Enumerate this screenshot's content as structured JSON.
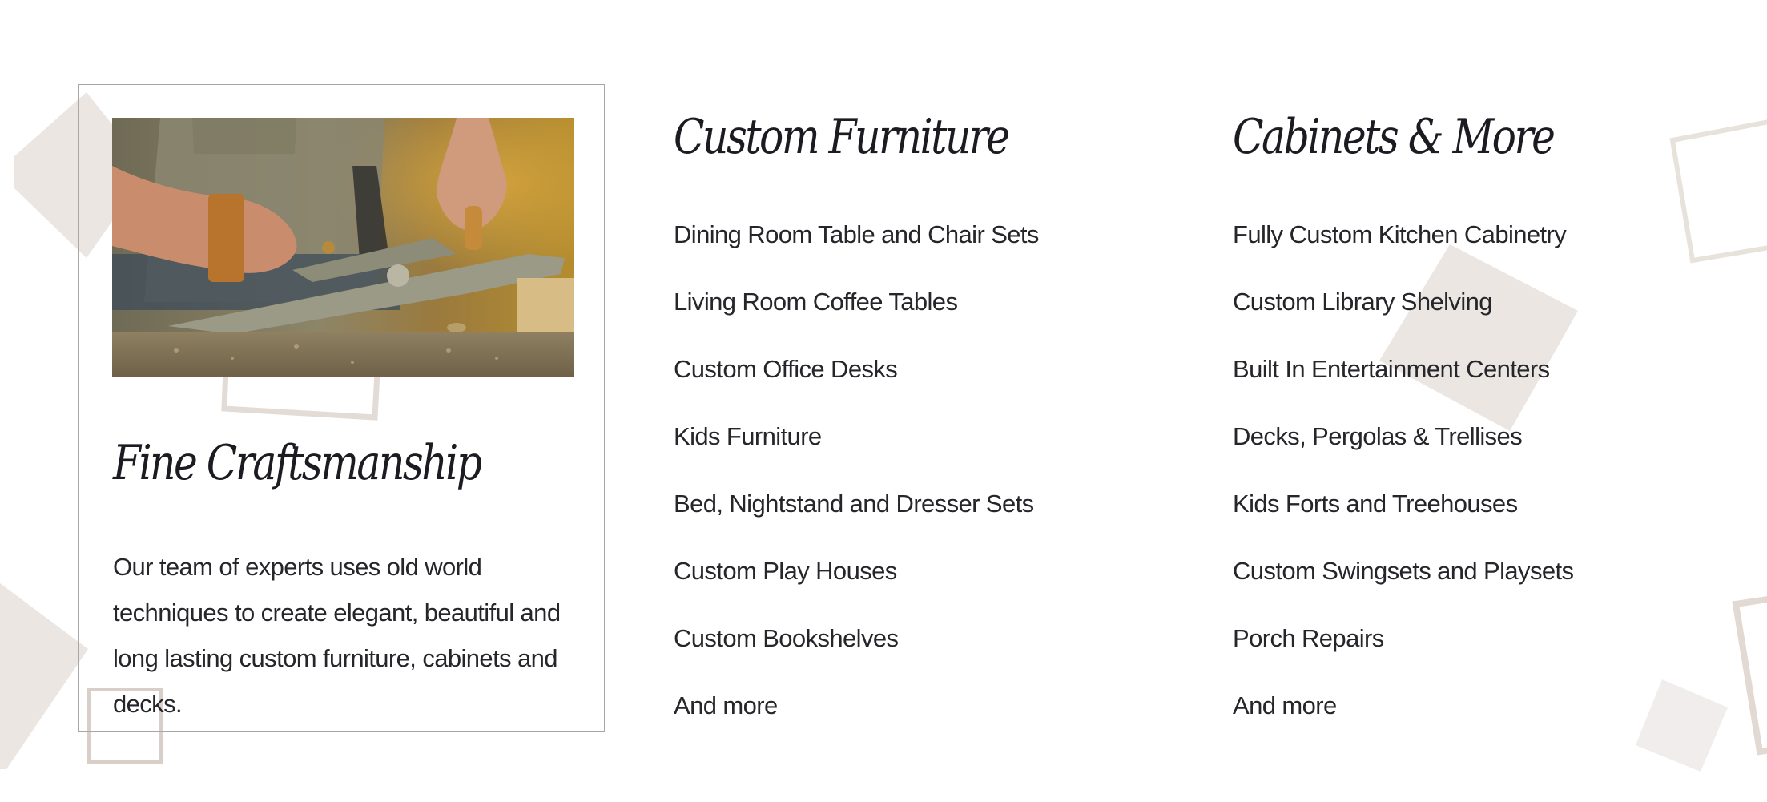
{
  "card": {
    "image_alt": "Craftsman using a hand plane on wood",
    "title": "Fine Craftsmanship",
    "description": "Our team of experts uses old world techniques to create elegant, beautiful and long lasting custom furniture, cabinets and decks."
  },
  "columns": [
    {
      "title": "Custom Furniture",
      "items": [
        "Dining Room Table and Chair Sets",
        "Living Room Coffee Tables",
        "Custom Office Desks",
        "Kids Furniture",
        "Bed, Nightstand and Dresser Sets",
        "Custom Play Houses",
        "Custom Bookshelves",
        "And more"
      ]
    },
    {
      "title": "Cabinets & More",
      "items": [
        "Fully Custom Kitchen Cabinetry",
        "Custom Library Shelving",
        "Built In Entertainment Centers",
        "Decks, Pergolas & Trellises",
        "Kids Forts and Treehouses",
        "Custom Swingsets and Playsets",
        "Porch Repairs",
        "And more"
      ]
    }
  ],
  "colors": {
    "text": "#25252a",
    "heading": "#1c1b22",
    "card_border": "#a9a6a6",
    "decor_fill": "#ebe6e2",
    "decor_fill_light": "#f1eded",
    "decor_stroke": "#e3dbd5"
  }
}
